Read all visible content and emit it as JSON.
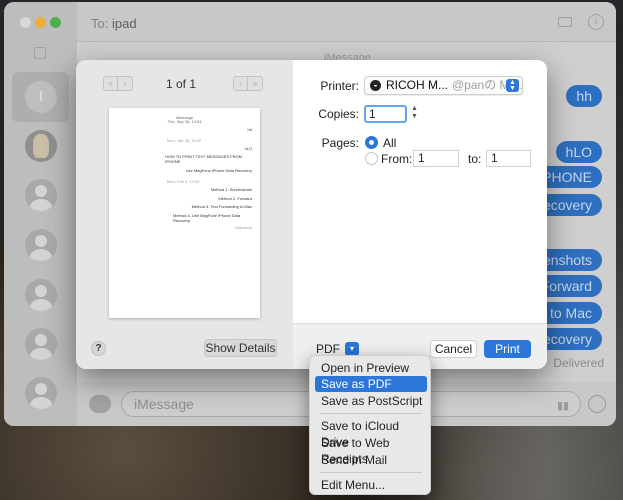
{
  "messages": {
    "to_prefix": "To:",
    "recipient": "ipad",
    "service_caption": "iMessage",
    "bubbles": [
      "hh",
      "hLO",
      "IPHONE",
      "Recovery",
      "enshots",
      "Forward",
      "g to Mac",
      "Recovery"
    ],
    "delivered": "Delivered",
    "input_placeholder": "iMessage",
    "contact_initial": "I",
    "bubble_color": "#2e6fbf"
  },
  "print_dialog": {
    "page_indicator": "1 of 1",
    "printer_label": "Printer:",
    "printer_name": "RICOH M...",
    "printer_suffix": "@panの Ma...",
    "copies_label": "Copies:",
    "copies_value": "1",
    "pages_label": "Pages:",
    "pages_all_label": "All",
    "pages_from_label": "From:",
    "pages_from_value": "1",
    "pages_to_label": "to:",
    "pages_to_value": "1",
    "help_label": "?",
    "show_details_label": "Show Details",
    "pdf_label": "PDF",
    "cancel_label": "Cancel",
    "print_label": "Print",
    "accent_color": "#2d76d9"
  },
  "preview_page": {
    "header_line1": "iMessage",
    "header_line2": "Thu, Sep 16, 12:04",
    "msg1": "hh",
    "date2": "Mon, Jan 26, 10:32",
    "msg2": "hLO",
    "msg3a": "HOW TO PRINT TEXT MESSAGES FROM",
    "msg3b": "IPHONE",
    "msg4": "Use MagFone iPhone Data Recovery",
    "date3": "Mon, Feb 2, 17:53",
    "msg5": "Method 1. Screenshots",
    "msg6": "Method 2. Forward",
    "msg7": "Method 3. Text Forwarding to Mac",
    "msg8a": "Method 4. Use MagFone iPhone Data",
    "msg8b": "Recovery",
    "delivered": "Delivered"
  },
  "pdf_menu": {
    "items": [
      "Open in Preview",
      "Save as PDF",
      "Save as PostScript",
      "Save to iCloud Drive",
      "Save to Web Receipts",
      "Send in Mail",
      "Edit Menu..."
    ],
    "highlighted_index": 1
  }
}
